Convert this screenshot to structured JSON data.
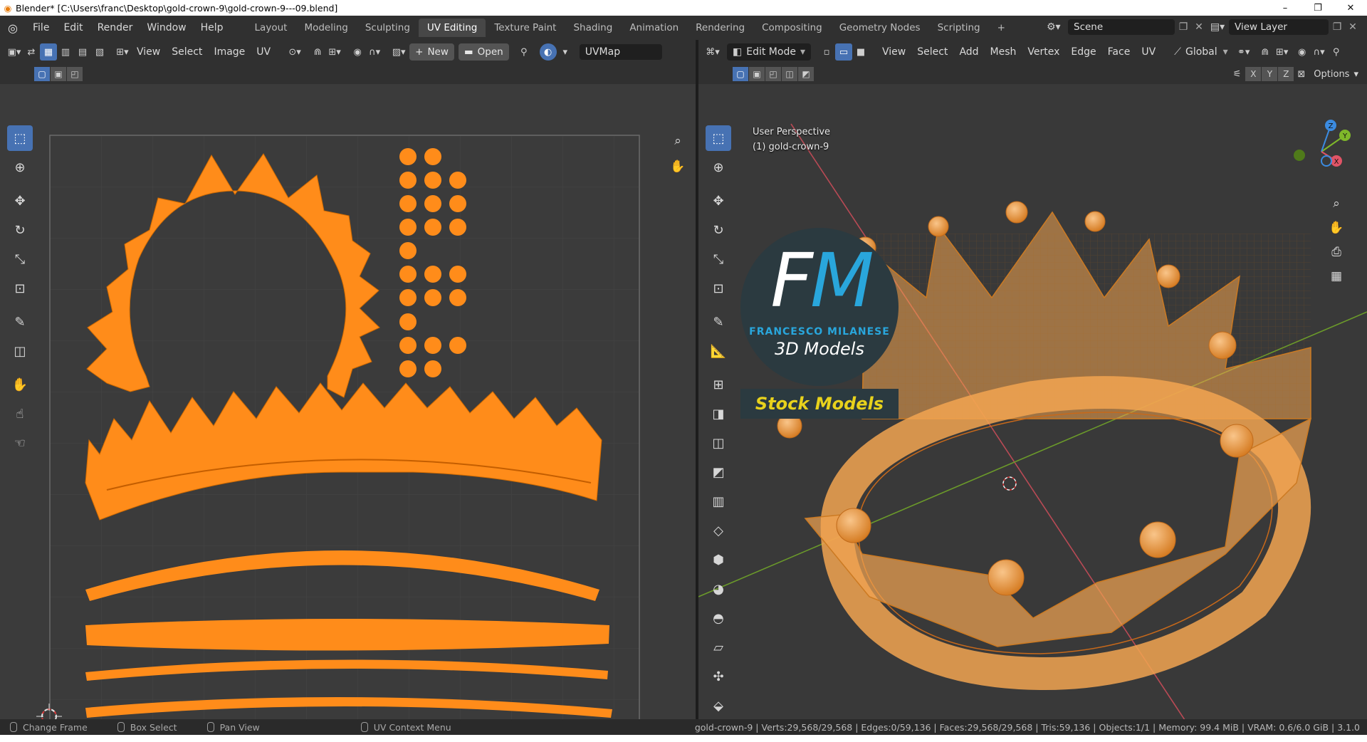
{
  "window": {
    "title": "Blender* [C:\\Users\\franc\\Desktop\\gold-crown-9\\gold-crown-9---09.blend]",
    "controls": [
      "–",
      "❐",
      "✕"
    ]
  },
  "menubar": {
    "items": [
      "File",
      "Edit",
      "Render",
      "Window",
      "Help"
    ],
    "workspaces": [
      "Layout",
      "Modeling",
      "Sculpting",
      "UV Editing",
      "Texture Paint",
      "Shading",
      "Animation",
      "Rendering",
      "Compositing",
      "Geometry Nodes",
      "Scripting"
    ],
    "active_workspace": "UV Editing",
    "add_tab": "+",
    "scene": "Scene",
    "view_layer": "View Layer"
  },
  "uv_editor": {
    "menus": [
      "View",
      "Select",
      "Image",
      "UV"
    ],
    "new_label": "New",
    "open_label": "Open",
    "uvmap": "UVMap"
  },
  "viewport": {
    "mode": "Edit Mode",
    "menus": [
      "View",
      "Select",
      "Add",
      "Mesh",
      "Vertex",
      "Edge",
      "Face",
      "UV"
    ],
    "orientation": "Global",
    "axes": [
      "X",
      "Y",
      "Z"
    ],
    "options_label": "Options",
    "perspective": "User Perspective",
    "object_label": "(1) gold-crown-9",
    "gizmo": [
      "X",
      "Y",
      "Z"
    ]
  },
  "logo": {
    "letters_f": "F",
    "letters_m": "M",
    "name": "FRANCESCO MILANESE",
    "subtitle": "3D Models",
    "banner": "Stock Models"
  },
  "statusbar": {
    "items": [
      "Change Frame",
      "Box Select",
      "Pan View",
      "UV Context Menu"
    ],
    "stats": "gold-crown-9 | Verts:29,568/29,568 | Edges:0/59,136 | Faces:29,568/29,568 | Tris:59,136 | Objects:1/1 | Memory: 99.4 MiB | VRAM: 0.6/6.0 GiB | 3.1.0"
  },
  "colors": {
    "accent": "#4772b3",
    "uv_orange": "#ff8c1a",
    "mesh_orange": "#f2a451",
    "x_axis": "#e05466",
    "y_axis": "#7fb82a",
    "z_axis": "#3b8be0"
  }
}
